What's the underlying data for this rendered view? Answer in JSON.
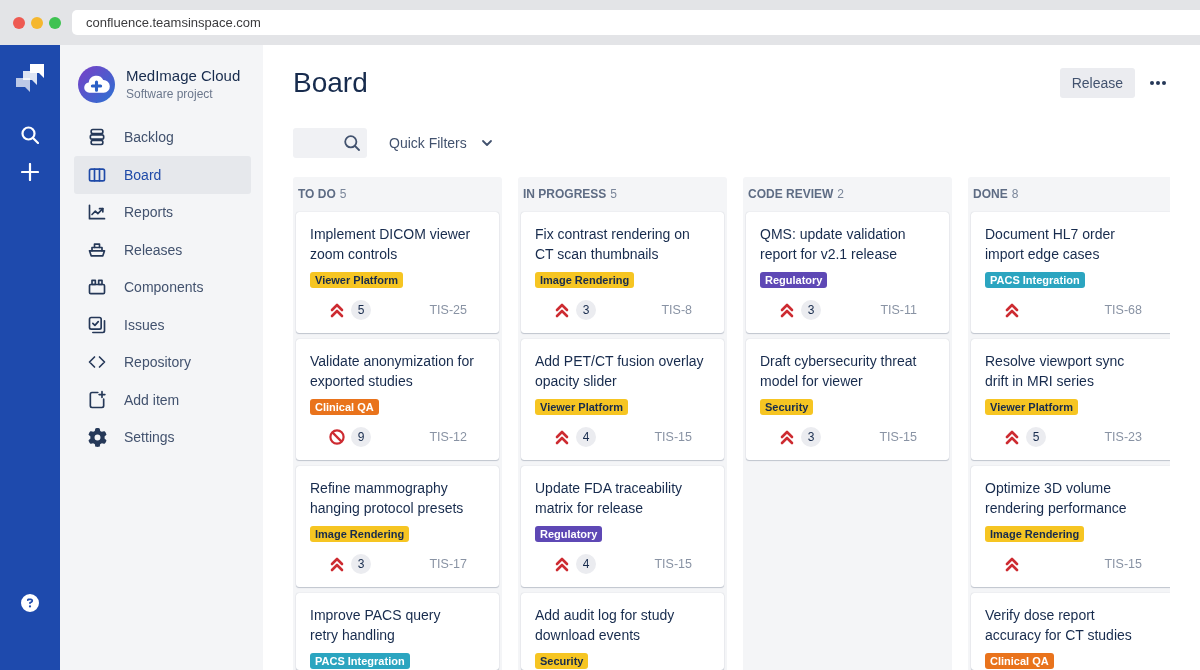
{
  "browser": {
    "url": "confluence.teamsinspace.com"
  },
  "project": {
    "name": "MedImage Cloud",
    "type": "Software project"
  },
  "sidebar": {
    "items": [
      {
        "label": "Backlog",
        "selected": false
      },
      {
        "label": "Board",
        "selected": true
      },
      {
        "label": "Reports",
        "selected": false
      },
      {
        "label": "Releases",
        "selected": false
      },
      {
        "label": "Components",
        "selected": false
      },
      {
        "label": "Issues",
        "selected": false
      },
      {
        "label": "Repository",
        "selected": false
      },
      {
        "label": "Add item",
        "selected": false
      },
      {
        "label": "Settings",
        "selected": false
      }
    ]
  },
  "header": {
    "title": "Board",
    "release_button": "Release"
  },
  "toolbar": {
    "quick_filters": "Quick Filters"
  },
  "board": {
    "columns": [
      {
        "name": "TO DO",
        "count": "5",
        "cards": [
          {
            "title": "Implement DICOM viewer\nzoom controls",
            "label": {
              "text": "Viewer Platform",
              "color": "#f6c522"
            },
            "priority": {
              "kind": "highest"
            },
            "count": "5",
            "key": "TIS-25"
          },
          {
            "title": "Validate anonymization for\nexported studies",
            "label": {
              "text": "Clinical QA",
              "color": "#e9731c"
            },
            "priority": {
              "kind": "blocker"
            },
            "count": "9",
            "key": "TIS-12"
          },
          {
            "title": "Refine mammography\nhanging protocol presets",
            "label": {
              "text": "Image Rendering",
              "color": "#f6c522"
            },
            "priority": {
              "kind": "highest"
            },
            "count": "3",
            "key": "TIS-17"
          },
          {
            "title": "Improve PACS query\nretry handling",
            "label": {
              "text": "PACS Integration",
              "color": "#2ba5c0"
            }
          }
        ]
      },
      {
        "name": "IN PROGRESS",
        "count": "5",
        "cards": [
          {
            "title": "Fix contrast rendering on\nCT scan thumbnails",
            "label": {
              "text": "Image Rendering",
              "color": "#f6c522"
            },
            "priority": {
              "kind": "highest"
            },
            "count": "3",
            "key": "TIS-8"
          },
          {
            "title": "Add PET/CT fusion overlay\nopacity slider",
            "label": {
              "text": "Viewer Platform",
              "color": "#f6c522"
            },
            "priority": {
              "kind": "highest"
            },
            "count": "4",
            "key": "TIS-15"
          },
          {
            "title": "Update FDA traceability\nmatrix for release",
            "label": {
              "text": "Regulatory",
              "color": "#5e48b5"
            },
            "priority": {
              "kind": "highest"
            },
            "count": "4",
            "key": "TIS-15"
          },
          {
            "title": "Add audit log for study\ndownload events",
            "label": {
              "text": "Security",
              "color": "#f6c522"
            }
          }
        ]
      },
      {
        "name": "CODE REVIEW",
        "count": "2",
        "cards": [
          {
            "title": "QMS: update validation\nreport for v2.1 release",
            "label": {
              "text": "Regulatory",
              "color": "#5e48b5"
            },
            "priority": {
              "kind": "highest"
            },
            "count": "3",
            "key": "TIS-11"
          },
          {
            "title": "Draft cybersecurity threat\nmodel for viewer",
            "label": {
              "text": "Security",
              "color": "#f6c522"
            },
            "priority": {
              "kind": "highest"
            },
            "count": "3",
            "key": "TIS-15"
          }
        ]
      },
      {
        "name": "DONE",
        "count": "8",
        "cards": [
          {
            "title": "Document HL7 order\nimport edge cases",
            "label": {
              "text": "PACS Integration",
              "color": "#2ba5c0"
            },
            "priority": {
              "kind": "highest"
            },
            "key": "TIS-68"
          },
          {
            "title": "Resolve viewport sync\ndrift in MRI series",
            "label": {
              "text": "Viewer Platform",
              "color": "#f6c522"
            },
            "priority": {
              "kind": "highest"
            },
            "count": "5",
            "key": "TIS-23"
          },
          {
            "title": "Optimize 3D volume\nrendering performance",
            "label": {
              "text": "Image Rendering",
              "color": "#f6c522"
            },
            "priority": {
              "kind": "highest"
            },
            "key": "TIS-15"
          },
          {
            "title": "Verify dose report\naccuracy for CT studies",
            "label": {
              "text": "Clinical QA",
              "color": "#e9731c"
            }
          }
        ]
      }
    ]
  }
}
